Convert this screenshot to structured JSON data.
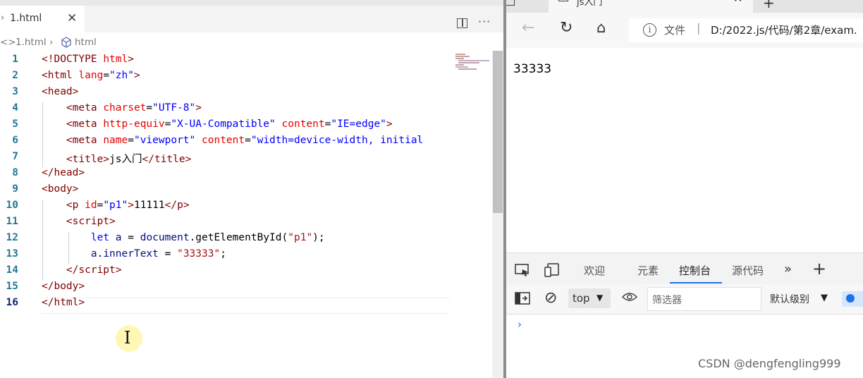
{
  "editor": {
    "tab": {
      "label": "1.html",
      "close": "✕",
      "chevron": "›"
    },
    "more": "···",
    "breadcrumb": {
      "icon": "<>",
      "file": "1.html",
      "sep": "›",
      "node": "html"
    },
    "lines": [
      {
        "n": "1",
        "html": "<span class='t'>&lt;!DOCTYPE</span> <span class='a'>html</span><span class='t'>&gt;</span>"
      },
      {
        "n": "2",
        "html": "<span class='t'>&lt;html</span> <span class='a'>lang</span><span class='d'>=</span><span class='s'>\"zh\"</span><span class='t'>&gt;</span>"
      },
      {
        "n": "3",
        "html": "<span class='t'>&lt;head&gt;</span>"
      },
      {
        "n": "4",
        "html": "    <span class='t'>&lt;meta</span> <span class='a'>charset</span><span class='d'>=</span><span class='s'>\"UTF-8\"</span><span class='t'>&gt;</span>"
      },
      {
        "n": "5",
        "html": "    <span class='t'>&lt;meta</span> <span class='a'>http-equiv</span><span class='d'>=</span><span class='s'>\"X-UA-Compatible\"</span> <span class='a'>content</span><span class='d'>=</span><span class='s'>\"IE=edge\"</span><span class='t'>&gt;</span>"
      },
      {
        "n": "6",
        "html": "    <span class='t'>&lt;meta</span> <span class='a'>name</span><span class='d'>=</span><span class='s'>\"viewport\"</span> <span class='a'>content</span><span class='d'>=</span><span class='s'>\"width=device-width, initial</span>"
      },
      {
        "n": "7",
        "html": "    <span class='t'>&lt;title&gt;</span><span class='d'>js入门</span><span class='t'>&lt;/title&gt;</span>"
      },
      {
        "n": "8",
        "html": "<span class='t'>&lt;/head&gt;</span>"
      },
      {
        "n": "9",
        "html": "<span class='t'>&lt;body&gt;</span>"
      },
      {
        "n": "10",
        "html": "    <span class='t'>&lt;p</span> <span class='a'>id</span><span class='d'>=</span><span class='s'>\"p1\"</span><span class='t'>&gt;</span><span class='d'>11111</span><span class='t'>&lt;/p&gt;</span>"
      },
      {
        "n": "11",
        "html": "    <span class='t'>&lt;script&gt;</span>"
      },
      {
        "n": "12",
        "html": "        <span class='k'>let</span> <span class='v'>a</span> <span class='d'>= </span><span class='v'>document</span><span class='d'>.getElementById(</span><span class='str'>\"p1\"</span><span class='d'>);</span>"
      },
      {
        "n": "13",
        "html": "        <span class='v'>a</span><span class='d'>.</span><span class='v'>innerText</span> <span class='d'>= </span><span class='str'>\"33333\"</span><span class='d'>;</span>"
      },
      {
        "n": "14",
        "html": "    <span class='t'>&lt;/script&gt;</span>"
      },
      {
        "n": "15",
        "html": "<span class='t'>&lt;/body&gt;</span>"
      },
      {
        "n": "16",
        "html": "<span class='t'>&lt;/html&gt;</span>"
      }
    ]
  },
  "browser": {
    "tab": {
      "label": "js入门",
      "close": "✕",
      "new": "+"
    },
    "nav": {
      "back": "←",
      "refresh": "↻",
      "home": "⌂"
    },
    "address": {
      "info": "i",
      "label": "文件",
      "sep": "|",
      "url": "D:/2022.js/代码/第2章/exam."
    },
    "page_text": "33333",
    "devtools": {
      "tabs": [
        {
          "label": "欢迎",
          "active": false
        },
        {
          "label": "元素",
          "active": false
        },
        {
          "label": "控制台",
          "active": true
        },
        {
          "label": "源代码",
          "active": false
        }
      ],
      "more": "»",
      "add": "+",
      "clear": "⊘",
      "context": "top",
      "dropdown": "▼",
      "eye": "👁",
      "filter_placeholder": "筛选器",
      "level": "默认级别",
      "prompt": "›"
    }
  },
  "watermark": "CSDN @dengfengling999"
}
